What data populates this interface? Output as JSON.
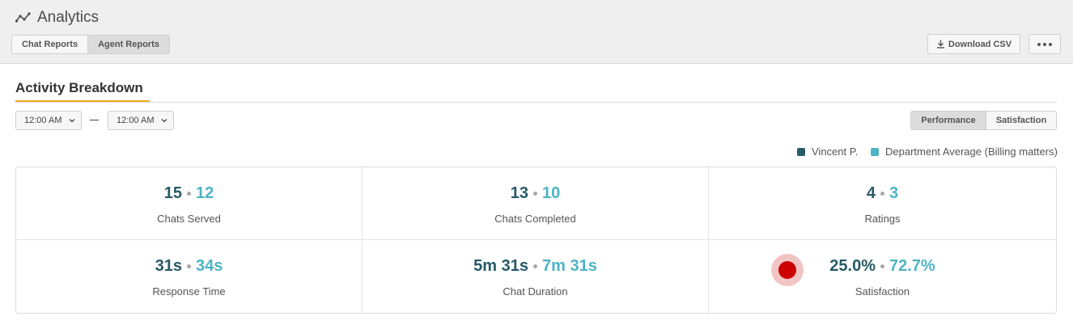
{
  "header": {
    "title": "Analytics",
    "icon": "analytics-line-icon"
  },
  "tabs": [
    {
      "label": "Chat Reports",
      "active": false
    },
    {
      "label": "Agent Reports",
      "active": true
    }
  ],
  "toolbar": {
    "download_label": "Download CSV",
    "download_icon": "download-icon",
    "more_icon": "more-dots-icon"
  },
  "section": {
    "title": "Activity Breakdown",
    "accent_color": "#f1a91c"
  },
  "time_range": {
    "from": "12:00 AM",
    "to": "12:00 AM"
  },
  "view_toggle": {
    "options": [
      "Performance",
      "Satisfaction"
    ],
    "selected": "Performance"
  },
  "legend": {
    "agent": {
      "label": "Vincent P.",
      "color": "#275a68"
    },
    "department": {
      "label": "Department Average (Billing matters)",
      "color": "#4cb4c4"
    }
  },
  "metrics": [
    {
      "label": "Chats Served",
      "agent": "15",
      "department": "12"
    },
    {
      "label": "Chats Completed",
      "agent": "13",
      "department": "10"
    },
    {
      "label": "Ratings",
      "agent": "4",
      "department": "3"
    },
    {
      "label": "Response Time",
      "agent": "31s",
      "department": "34s"
    },
    {
      "label": "Chat Duration",
      "agent": "5m 31s",
      "department": "7m 31s"
    },
    {
      "label": "Satisfaction",
      "agent": "25.0%",
      "department": "72.7%"
    }
  ],
  "alert_indicator": {
    "color": "#cc0000",
    "icon": "red-alert-dot"
  }
}
